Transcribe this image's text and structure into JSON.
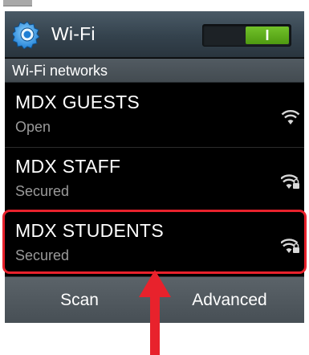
{
  "header": {
    "title": "Wi-Fi",
    "icon": "gear-icon",
    "toggle": {
      "state_label": "I",
      "on": true,
      "accent": "#5fb11d"
    }
  },
  "section": {
    "title": "Wi-Fi networks"
  },
  "networks": [
    {
      "name": "MDX GUESTS",
      "status": "Open",
      "icon": "wifi-open-icon"
    },
    {
      "name": "MDX STAFF",
      "status": "Secured",
      "icon": "wifi-secured-icon"
    },
    {
      "name": "MDX STUDENTS",
      "status": "Secured",
      "icon": "wifi-secured-icon"
    }
  ],
  "footer": {
    "scan_label": "Scan",
    "advanced_label": "Advanced"
  },
  "annotation": {
    "highlight_color": "#e8222c",
    "highlighted_network": "MDX STUDENTS"
  }
}
